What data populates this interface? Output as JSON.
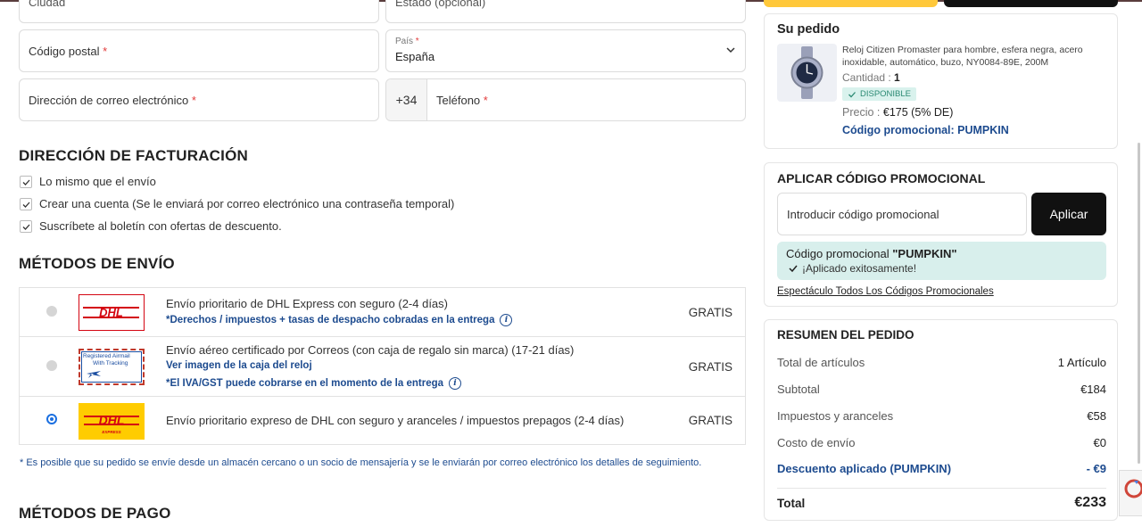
{
  "form": {
    "city_placeholder": "Ciudad",
    "state_placeholder": "Estado (opcional)",
    "postal_label": "Código postal",
    "country_label": "País",
    "country_value": "España",
    "email_label": "Dirección de correo electrónico",
    "phone_prefix": "+34",
    "phone_label": "Teléfono",
    "required_mark": "*"
  },
  "billing": {
    "heading": "DIRECCIÓN DE FACTURACIÓN",
    "options": [
      {
        "label": "Lo mismo que el envío",
        "checked": true
      },
      {
        "label": "Crear una cuenta (Se le enviará por correo electrónico una contraseña temporal)",
        "checked": true
      },
      {
        "label": "Suscríbete al boletín con ofertas de descuento.",
        "checked": true
      }
    ]
  },
  "shipping": {
    "heading": "MÉTODOS DE ENVÍO",
    "methods": [
      {
        "title": "Envío prioritario de DHL Express con seguro (2-4 días)",
        "note1": "*Derechos / impuestos + tasas de despacho cobradas en la entrega",
        "price": "GRATIS",
        "selected": false,
        "logo": "dhl-outline-logo"
      },
      {
        "title": "Envío aéreo certificado por Correos (con caja de regalo sin marca) (17-21 días)",
        "note1": "Ver imagen de la caja del reloj",
        "note2": "*El IVA/GST puede cobrarse en el momento de la entrega",
        "price": "GRATIS",
        "selected": false,
        "logo": "registered-airmail-logo"
      },
      {
        "title": "Envío prioritario expreso de DHL con seguro y aranceles / impuestos prepagos (2-4 días)",
        "price": "GRATIS",
        "selected": true,
        "logo": "dhl-yellow-logo"
      }
    ],
    "footnote": "* Es posible que su pedido se envíe desde un almacén cercano o un socio de mensajería y se le enviarán por correo electrónico los detalles de seguimiento."
  },
  "payment": {
    "heading": "MÉTODOS DE PAGO"
  },
  "logos": {
    "dhl": "DHL",
    "dhl_express": "EXPRESS",
    "airmail_1": "Registered Airmail",
    "airmail_2": "With Tracking"
  },
  "order": {
    "heading": "Su pedido",
    "product_name": "Reloj Citizen Promaster para hombre, esfera negra, acero inoxidable, automático, buzo, NY0084-89E, 200M",
    "qty_label": "Cantidad :",
    "qty_value": "1",
    "stock_badge": "DISPONIBLE",
    "price_label": "Precio :",
    "price_value": "€175 (5% DE)",
    "promo_line": "Código promocional: PUMPKIN"
  },
  "promo": {
    "heading": "APLICAR CÓDIGO PROMOCIONAL",
    "input_placeholder": "Introducir código promocional",
    "apply_label": "Aplicar",
    "applied_prefix": "Código promocional ",
    "applied_code": "\"PUMPKIN\"",
    "applied_status": "¡Aplicado exitosamente!",
    "all_codes_link": "Espectáculo Todos Los Códigos Promocionales"
  },
  "summary": {
    "heading": "RESUMEN DEL PEDIDO",
    "rows": [
      {
        "label": "Total de artículos",
        "value": "1 Artículo"
      },
      {
        "label": "Subtotal",
        "value": "€184"
      },
      {
        "label": "Impuestos y aranceles",
        "value": "€58"
      },
      {
        "label": "Costo de envío",
        "value": "€0"
      },
      {
        "label": "Descuento aplicado (PUMPKIN)",
        "value": "- €9"
      }
    ],
    "total_label": "Total",
    "total_value": "€233"
  },
  "colors": {
    "accent": "#1d4b8f",
    "dhl_red": "#d40511",
    "dhl_yellow": "#ffcc00",
    "promo_bg": "#d8efec"
  }
}
